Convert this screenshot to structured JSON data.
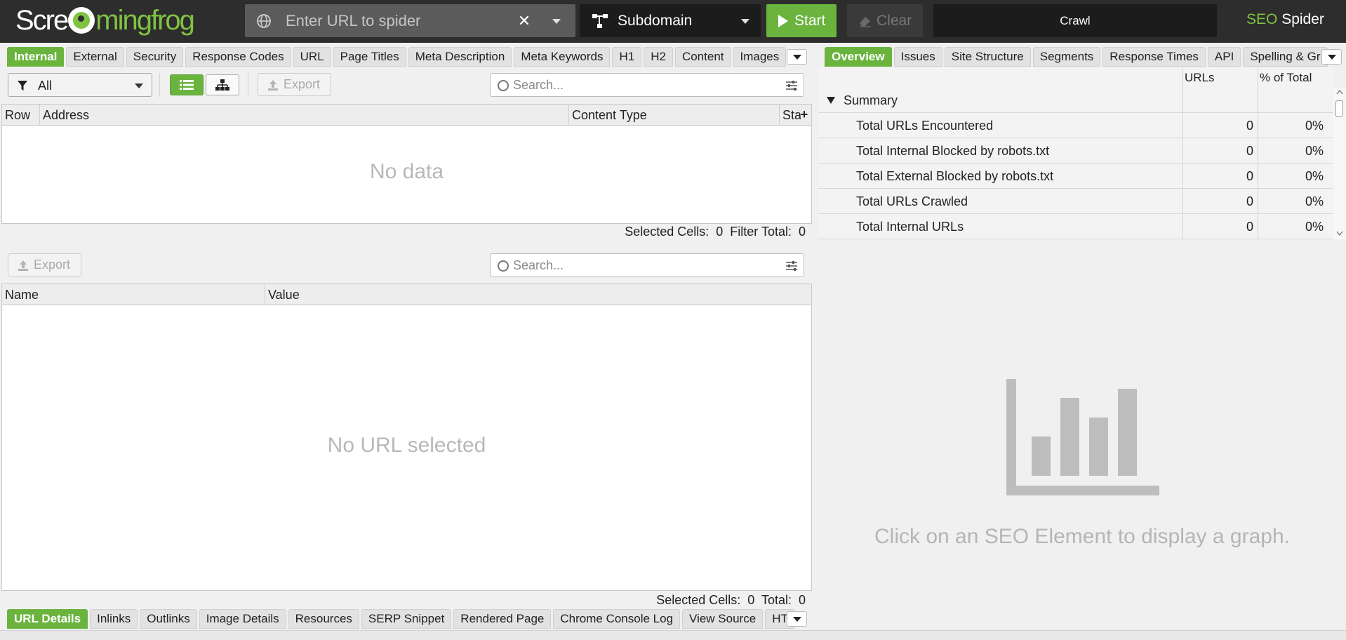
{
  "header": {
    "logo_part1": "Scre",
    "logo_part2": "mingfrog",
    "url_placeholder": "Enter URL to spider",
    "mode_label": "Subdomain",
    "start_label": "Start",
    "clear_label": "Clear",
    "crawl_label": "Crawl",
    "product_part1": "SEO",
    "product_part2": " Spider"
  },
  "main_tabs": [
    "Internal",
    "External",
    "Security",
    "Response Codes",
    "URL",
    "Page Titles",
    "Meta Description",
    "Meta Keywords",
    "H1",
    "H2",
    "Content",
    "Images"
  ],
  "toolbar": {
    "filter_value": "All",
    "export_label": "Export",
    "search_placeholder": "Search..."
  },
  "top_table": {
    "columns": [
      "Row",
      "Address",
      "Content Type",
      "Sta"
    ],
    "empty_text": "No data",
    "status_text": "Selected Cells:  0  Filter Total:  0"
  },
  "lower": {
    "export_label": "Export",
    "search_placeholder": "Search...",
    "columns": [
      "Name",
      "Value"
    ],
    "empty_text": "No URL selected",
    "status_text": "Selected Cells:  0  Total:  0"
  },
  "bottom_tabs": [
    "URL Details",
    "Inlinks",
    "Outlinks",
    "Image Details",
    "Resources",
    "SERP Snippet",
    "Rendered Page",
    "Chrome Console Log",
    "View Source",
    "HT"
  ],
  "right_tabs": [
    "Overview",
    "Issues",
    "Site Structure",
    "Segments",
    "Response Times",
    "API",
    "Spelling & Gr"
  ],
  "overview": {
    "col_urls": "URLs",
    "col_pct": "% of Total",
    "group_label": "Summary",
    "rows": [
      {
        "name": "Total URLs Encountered",
        "urls": "0",
        "pct": "0%"
      },
      {
        "name": "Total Internal Blocked by robots.txt",
        "urls": "0",
        "pct": "0%"
      },
      {
        "name": "Total External Blocked by robots.txt",
        "urls": "0",
        "pct": "0%"
      },
      {
        "name": "Total URLs Crawled",
        "urls": "0",
        "pct": "0%"
      },
      {
        "name": "Total Internal URLs",
        "urls": "0",
        "pct": "0%"
      }
    ]
  },
  "graph": {
    "message": "Click on an SEO Element to display a graph."
  },
  "colors": {
    "accent_green": "#6ab43e",
    "dark_bar": "#2d2d2d"
  }
}
